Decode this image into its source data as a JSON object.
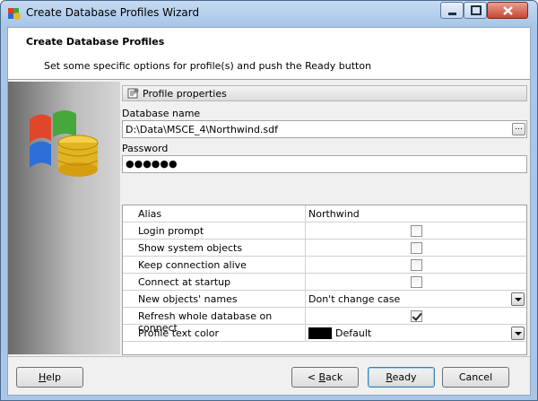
{
  "window": {
    "title": "Create Database Profiles Wizard"
  },
  "header": {
    "title": "Create Database Profiles",
    "subtitle": "Set some specific options for profile(s) and push the Ready button"
  },
  "group": {
    "title": "Profile properties"
  },
  "database": {
    "label": "Database name",
    "value": "D:\\Data\\MSCE_4\\Northwind.sdf",
    "browse": "..."
  },
  "password": {
    "label": "Password",
    "value": "●●●●●●"
  },
  "properties": [
    {
      "name": "Alias",
      "value": "Northwind"
    },
    {
      "name": "Login prompt",
      "checked": false
    },
    {
      "name": "Show system objects",
      "checked": false
    },
    {
      "name": "Keep connection alive",
      "checked": false
    },
    {
      "name": "Connect at startup",
      "checked": false
    },
    {
      "name": "New objects' names",
      "value": "Don't change case"
    },
    {
      "name": "Refresh whole database on connect",
      "checked": true
    },
    {
      "name": "Profile text color",
      "value": "Default",
      "color": "#000000"
    }
  ],
  "buttons": {
    "help_u": "H",
    "help_rest": "elp",
    "back_pre": "< ",
    "back_u": "B",
    "back_rest": "ack",
    "ready_u": "R",
    "ready_rest": "eady",
    "cancel": "Cancel"
  }
}
